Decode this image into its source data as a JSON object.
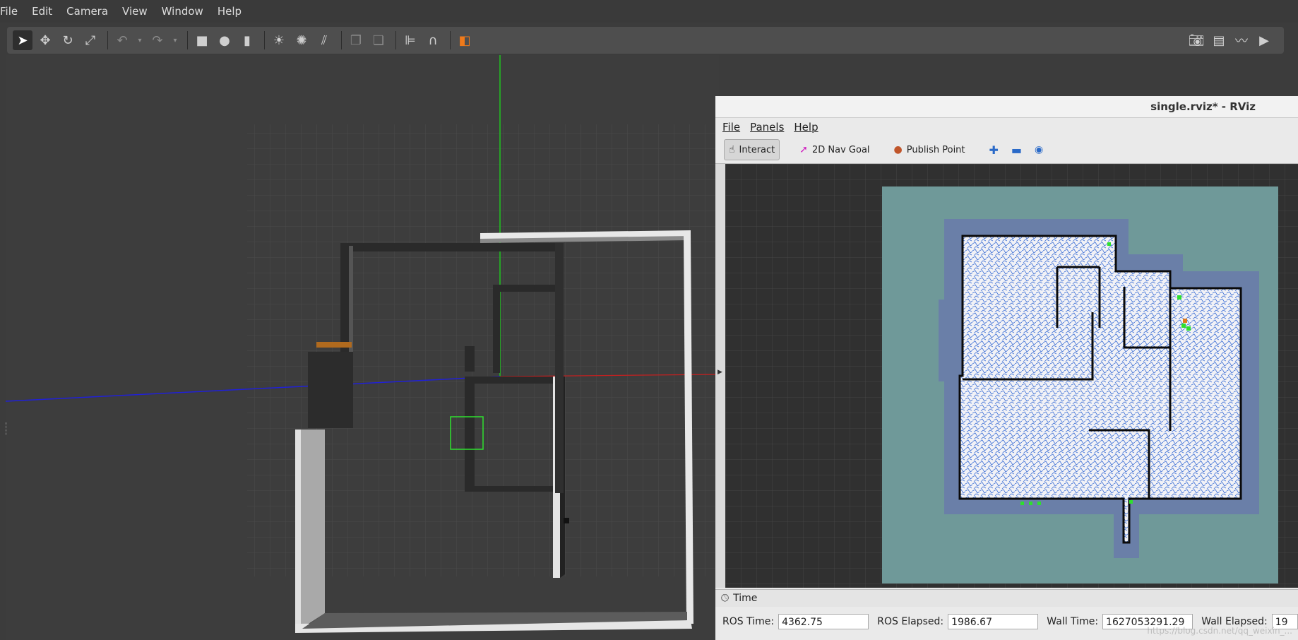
{
  "gazebo": {
    "menu": [
      "File",
      "Edit",
      "Camera",
      "View",
      "Window",
      "Help"
    ],
    "toolbar_icons": [
      "select-arrow-icon",
      "translate-icon",
      "rotate-icon",
      "scale-icon",
      "undo-icon",
      "undo-dropdown-icon",
      "redo-icon",
      "redo-dropdown-icon",
      "box-icon",
      "sphere-icon",
      "cylinder-icon",
      "sun-light-icon",
      "point-light-icon",
      "spot-light-icon",
      "copy-icon",
      "paste-icon",
      "align-icon",
      "snap-icon",
      "color-cube-icon"
    ],
    "right_icons": [
      "camera-icon",
      "log-icon",
      "plot-icon",
      "record-icon"
    ]
  },
  "rviz": {
    "title": "single.rviz* - RViz",
    "menu": [
      "File",
      "Panels",
      "Help"
    ],
    "tools": {
      "interact": "Interact",
      "nav_goal": "2D Nav Goal",
      "publish_point": "Publish Point"
    },
    "time_panel": {
      "header": "Time",
      "ros_time_label": "ROS Time:",
      "ros_time": "4362.75",
      "ros_elapsed_label": "ROS Elapsed:",
      "ros_elapsed": "1986.67",
      "wall_time_label": "Wall Time:",
      "wall_time": "1627053291.29",
      "wall_elapsed_label": "Wall Elapsed:",
      "wall_elapsed": "19"
    }
  },
  "watermark": "https://blog.csdn.net/qq_weixin_..."
}
